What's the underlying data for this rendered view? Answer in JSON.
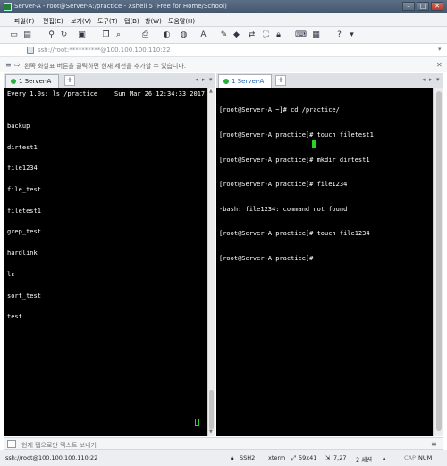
{
  "window": {
    "title": "Server-A - root@Server-A:/practice - Xshell 5 (Free for Home/School)"
  },
  "menu": [
    "파일(F)",
    "편집(E)",
    "보기(V)",
    "도구(T)",
    "탭(B)",
    "창(W)",
    "도움말(H)"
  ],
  "address": {
    "text": "ssh://root:**********@100.100.100.110:22"
  },
  "hint": {
    "text": "왼쪽 화살표 버튼을 클릭하면 현재 세션을 추가할 수 있습니다."
  },
  "tabs": {
    "left": {
      "label": "1 Server-A"
    },
    "right": {
      "label": "1 Server-A"
    },
    "plus": "+"
  },
  "left_terminal": {
    "header": "Every 1.0s: ls /practice",
    "header_time": "Sun Mar 26 12:34:33 2017",
    "entries": [
      "backup",
      "dirtest1",
      "file1234",
      "file_test",
      "filetest1",
      "grep_test",
      "hardlink",
      "ls",
      "sort_test",
      "test"
    ]
  },
  "right_terminal": {
    "lines": [
      "[root@Server-A ~]# cd /practice/",
      "[root@Server-A practice]# touch filetest1",
      "[root@Server-A practice]# mkdir dirtest1",
      "[root@Server-A practice]# file1234",
      "-bash: file1234: command not found",
      "[root@Server-A practice]# touch file1234",
      "[root@Server-A practice]# "
    ]
  },
  "sendbar": {
    "text": "현재 탭으로만 텍스트 보내기"
  },
  "status": {
    "connection": "ssh://root@100.100.100.110:22",
    "protocol": "SSH2",
    "terminal": "xterm",
    "size": "59x41",
    "cursor": "7,27",
    "sessions": "2 세션",
    "cap": "CAP",
    "num": "NUM"
  }
}
